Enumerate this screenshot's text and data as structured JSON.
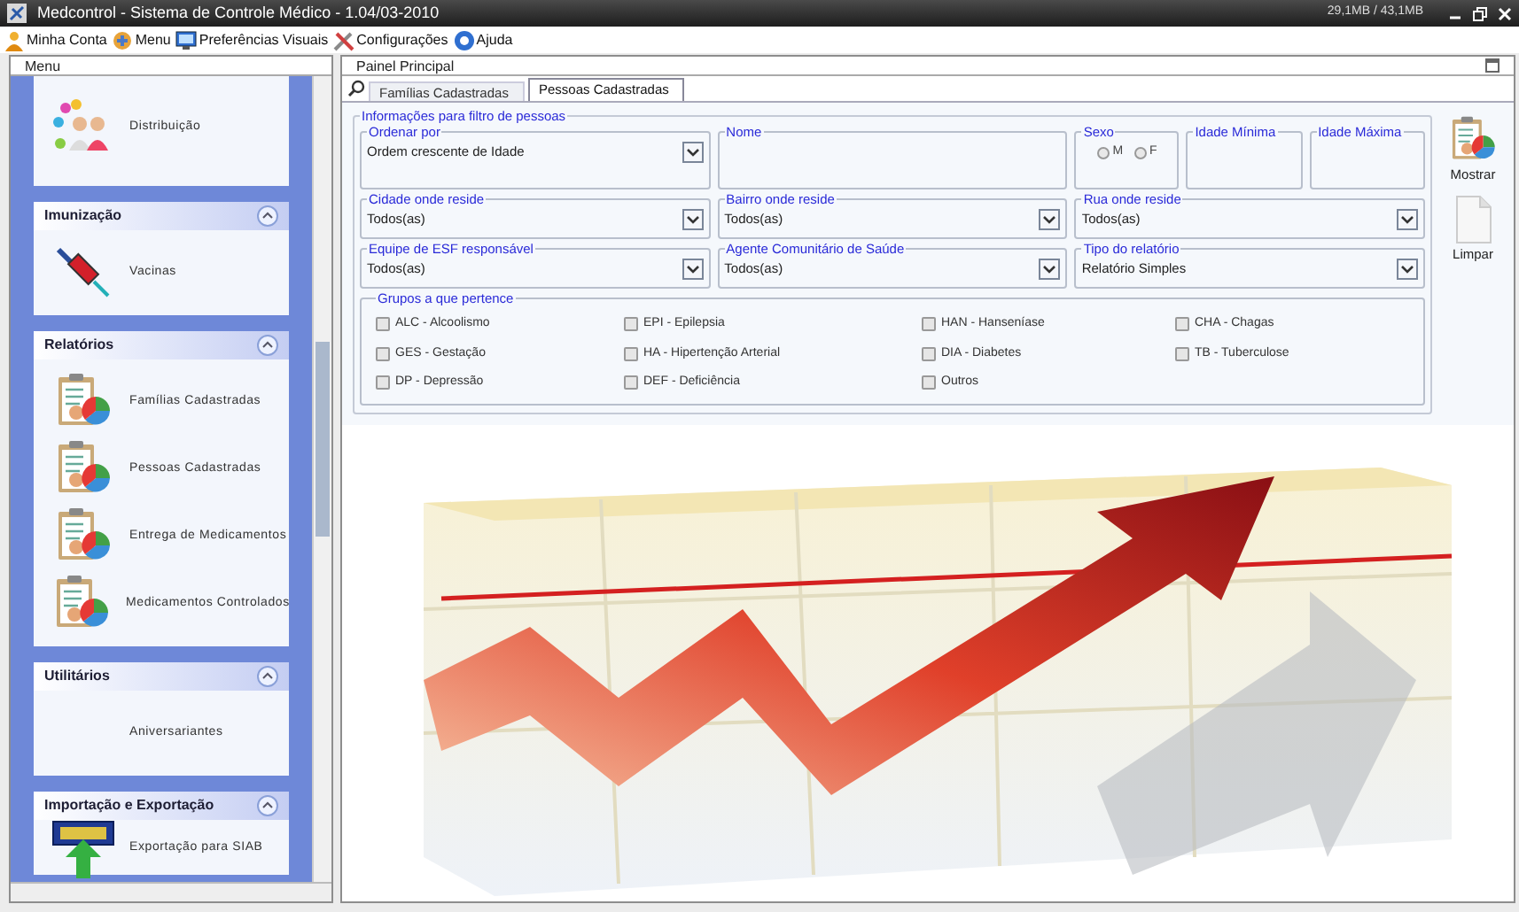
{
  "window": {
    "title": "Medcontrol - Sistema de Controle Médico - 1.04/03-2010",
    "memory": "29,1MB / 43,1MB"
  },
  "menu_bar": [
    {
      "label": "Minha Conta"
    },
    {
      "label": "Menu"
    },
    {
      "label": "Preferências Visuais"
    },
    {
      "label": "Configurações"
    },
    {
      "label": "Ajuda"
    }
  ],
  "sidebar": {
    "title": "Menu",
    "sections": [
      {
        "items": [
          {
            "label": "Distribuição"
          }
        ]
      },
      {
        "title": "Imunização",
        "expanded": true,
        "items": [
          {
            "label": "Vacinas"
          }
        ]
      },
      {
        "title": "Relatórios",
        "expanded": true,
        "items": [
          {
            "label": "Famílias Cadastradas"
          },
          {
            "label": "Pessoas Cadastradas"
          },
          {
            "label": "Entrega de Medicamentos"
          },
          {
            "label": "Medicamentos Controlados"
          }
        ]
      },
      {
        "title": "Utilitários",
        "expanded": true,
        "items": [
          {
            "label": "Aniversariantes"
          }
        ]
      },
      {
        "title": "Importação e Exportação",
        "expanded": true,
        "items": [
          {
            "label": "Exportação para SIAB"
          }
        ]
      }
    ]
  },
  "main": {
    "title": "Painel Principal",
    "tabs": [
      {
        "label": "Famílias Cadastradas",
        "selected": false
      },
      {
        "label": "Pessoas Cadastradas",
        "selected": true
      }
    ],
    "filter": {
      "title": "Informações para filtro de pessoas",
      "rows": [
        [
          {
            "kind": "select",
            "label": "Ordenar por",
            "value": "Ordem crescente de Idade"
          },
          {
            "kind": "text",
            "label": "Nome"
          },
          {
            "kind": "radio",
            "label": "Sexo",
            "options": [
              {
                "label": "M",
                "selected": false
              },
              {
                "label": "F",
                "selected": false
              }
            ]
          },
          {
            "kind": "text",
            "label": "Idade Mínima"
          },
          {
            "kind": "text",
            "label": "Idade Máxima"
          }
        ],
        [
          {
            "kind": "select",
            "label": "Cidade onde reside",
            "value": "Todos(as)"
          },
          {
            "kind": "select",
            "label": "Bairro onde reside",
            "value": "Todos(as)"
          },
          {
            "kind": "select",
            "label": "Rua onde reside",
            "value": "Todos(as)"
          }
        ],
        [
          {
            "kind": "select",
            "label": "Equipe de ESF responsável",
            "value": "Todos(as)"
          },
          {
            "kind": "select",
            "label": "Agente Comunitário de Saúde",
            "value": "Todos(as)"
          },
          {
            "kind": "select",
            "label": "Tipo do relatório",
            "value": "Relatório Simples"
          }
        ]
      ],
      "groups": {
        "title": "Grupos a que pertence",
        "items": [
          {
            "label": "ALC - Alcoolismo",
            "checked": false
          },
          {
            "label": "EPI - Epilepsia",
            "checked": false
          },
          {
            "label": "HAN - Hanseníase",
            "checked": false
          },
          {
            "label": "CHA - Chagas",
            "checked": false
          },
          {
            "label": "GES - Gestação",
            "checked": false
          },
          {
            "label": "HA - Hipertenção Arterial",
            "checked": false
          },
          {
            "label": "DIA - Diabetes",
            "checked": false
          },
          {
            "label": "TB - Tuberculose",
            "checked": false
          },
          {
            "label": "DP - Depressão",
            "checked": false
          },
          {
            "label": "DEF - Deficiência",
            "checked": false
          },
          {
            "label": "Outros",
            "checked": false
          }
        ]
      }
    },
    "actions": [
      {
        "label": "Mostrar"
      },
      {
        "label": "Limpar"
      }
    ]
  }
}
